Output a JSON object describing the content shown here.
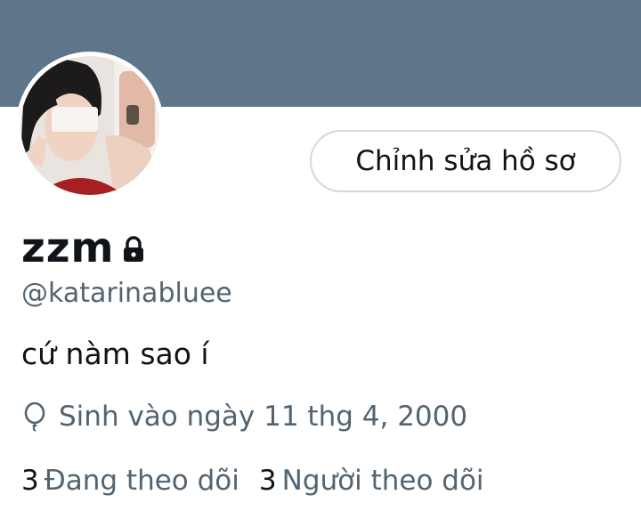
{
  "profile": {
    "display_name": "zzm",
    "handle": "@katarinabluee",
    "bio": "cứ nàm sao í",
    "birthday": "Sinh vào ngày 11 thg 4,  2000",
    "edit_button_label": "Chỉnh sửa hồ sơ",
    "following_count": "3",
    "following_label": "Đang theo dõi",
    "followers_count": "3",
    "followers_label": "Người theo dõi",
    "locked_icon": "lock-icon",
    "birthday_icon": "balloon-icon"
  },
  "colors": {
    "banner": "#5f7589",
    "text_primary": "#0f1419",
    "text_secondary": "#536471",
    "button_border": "#cfd9de"
  }
}
